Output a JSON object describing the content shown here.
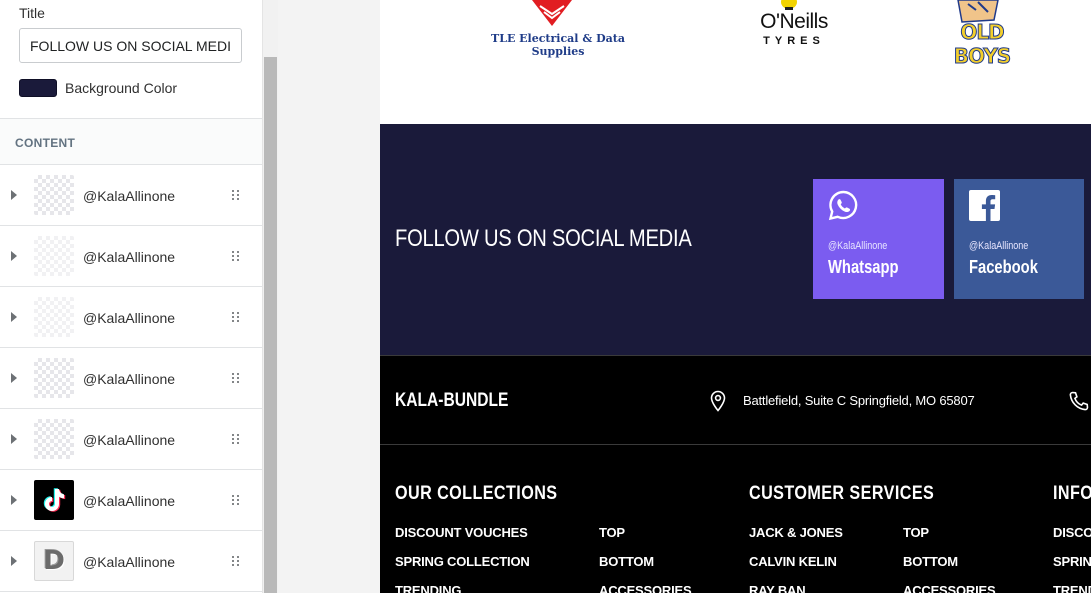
{
  "panel": {
    "title_label": "Title",
    "title_value": "FOLLOW US ON SOCIAL MEDIA",
    "background_color_label": "Background Color",
    "background_color": "#1a1a3a",
    "content_section_label": "CONTENT",
    "content_items": [
      {
        "label": "@KalaAllinone",
        "thumb": "placeholder"
      },
      {
        "label": "@KalaAllinone",
        "thumb": "placeholder"
      },
      {
        "label": "@KalaAllinone",
        "thumb": "placeholder"
      },
      {
        "label": "@KalaAllinone",
        "thumb": "placeholder"
      },
      {
        "label": "@KalaAllinone",
        "thumb": "placeholder"
      },
      {
        "label": "@KalaAllinone",
        "thumb": "tiktok-icon"
      },
      {
        "label": "@KalaAllinone",
        "thumb": "d-logo",
        "thumb_text": "D"
      }
    ]
  },
  "preview": {
    "logos": {
      "tle": "TLE Electrical & Data Supplies",
      "oneills_name": "O'Neills",
      "oneills_sub": "TYRES",
      "oldboys": "OLD BOYS"
    },
    "social": {
      "title": "FOLLOW US ON SOCIAL MEDIA",
      "cards": [
        {
          "handle": "@KalaAllinone",
          "network": "Whatsapp",
          "icon": "whatsapp-icon",
          "color": "#7b5cf0"
        },
        {
          "handle": "@KalaAllinone",
          "network": "Facebook",
          "icon": "facebook-icon",
          "color": "#3b5998"
        }
      ]
    },
    "footer": {
      "brand": "KALA-BUNDLE",
      "address": "Battlefield, Suite C Springfield, MO 65807",
      "columns": [
        {
          "title": "OUR COLLECTIONS",
          "links_a": [
            "DISCOUNT VOUCHES",
            "SPRING COLLECTION",
            "TRENDING"
          ],
          "links_b": [
            "TOP",
            "BOTTOM",
            "ACCESSORIES"
          ]
        },
        {
          "title": "CUSTOMER SERVICES",
          "links_a": [
            "JACK & JONES",
            "CALVIN KELIN",
            "RAY BAN"
          ],
          "links_b": [
            "TOP",
            "BOTTOM",
            "ACCESSORIES"
          ]
        },
        {
          "title": "INFO",
          "links_a": [
            "DISCO",
            "SPRIN",
            "TREND"
          ]
        }
      ]
    }
  }
}
